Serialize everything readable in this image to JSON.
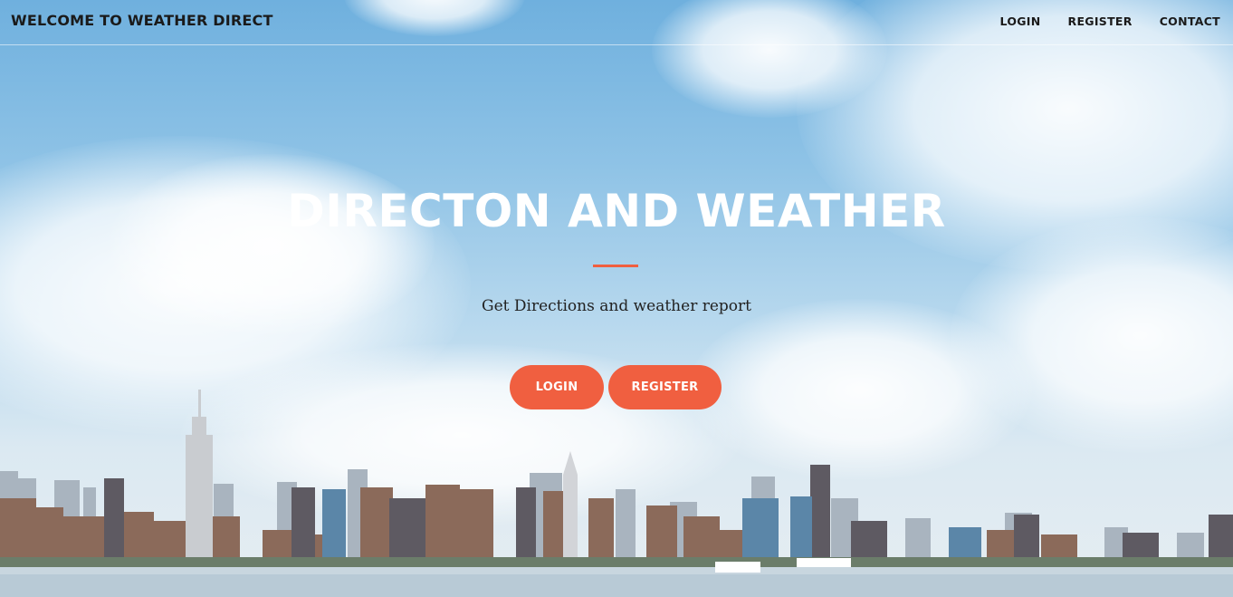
{
  "navbar": {
    "brand": "WELCOME TO WEATHER DIRECT",
    "links": [
      {
        "label": "LOGIN"
      },
      {
        "label": "REGISTER"
      },
      {
        "label": "CONTACT"
      }
    ]
  },
  "hero": {
    "title": "DIRECTON AND WEATHER",
    "subtitle": "Get Directions and weather report",
    "buttons": {
      "login_label": "LOGIN",
      "register_label": "REGISTER"
    }
  },
  "colors": {
    "accent": "#f05f40",
    "sky_top": "#6fb0de",
    "text_dark": "#1a1a1a"
  }
}
